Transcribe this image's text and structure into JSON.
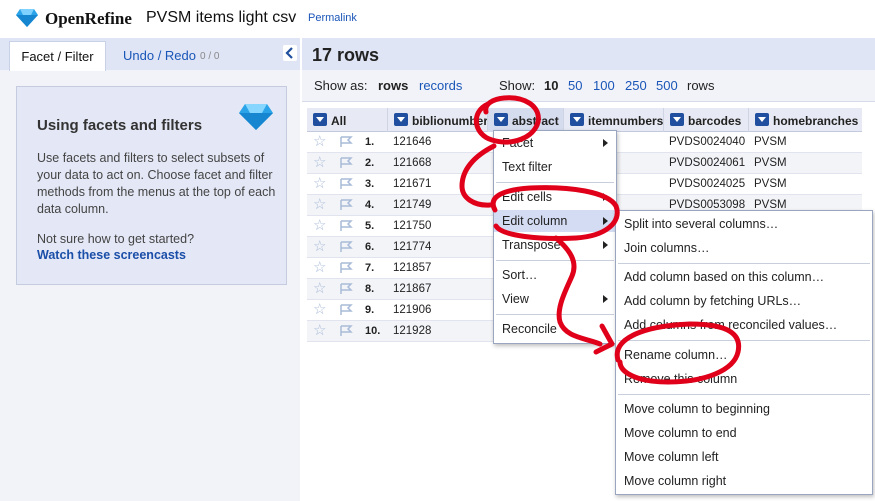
{
  "header": {
    "logo_text": "OpenRefine",
    "project_title": "PVSM items light csv",
    "permalink": "Permalink"
  },
  "left_panel": {
    "tab_facet": "Facet / Filter",
    "tab_undo": "Undo / Redo",
    "tab_undo_count": "0 / 0",
    "heading": "Using facets and filters",
    "description": "Use facets and filters to select subsets of your data to act on. Choose facet and filter methods from the menus at the top of each data column.",
    "help_question": "Not sure how to get started?",
    "help_link": "Watch these screencasts"
  },
  "main": {
    "row_count": "17 rows",
    "show_as_label": "Show as:",
    "mode_rows": "rows",
    "mode_records": "records",
    "show_label": "Show:",
    "page_sizes": [
      "10",
      "50",
      "100",
      "250",
      "500"
    ],
    "rows_suffix": "rows"
  },
  "table": {
    "columns": [
      "All",
      "biblionumber",
      "abstract",
      "itemnumbers",
      "barcodes",
      "homebranches"
    ],
    "rows": [
      {
        "n": "1.",
        "bib": "121646",
        "barcode": "PVDS0024040",
        "home": "PVSM"
      },
      {
        "n": "2.",
        "bib": "121668",
        "barcode": "PVDS0024061",
        "home": "PVSM"
      },
      {
        "n": "3.",
        "bib": "121671",
        "barcode": "PVDS0024025",
        "home": "PVSM"
      },
      {
        "n": "4.",
        "bib": "121749",
        "barcode": "PVDS0053098",
        "home": "PVSM"
      },
      {
        "n": "5.",
        "bib": "121750",
        "barcode": "",
        "home": ""
      },
      {
        "n": "6.",
        "bib": "121774",
        "barcode": "",
        "home": ""
      },
      {
        "n": "7.",
        "bib": "121857",
        "barcode": "",
        "home": ""
      },
      {
        "n": "8.",
        "bib": "121867",
        "barcode": "",
        "home": ""
      },
      {
        "n": "9.",
        "bib": "121906",
        "barcode": "",
        "home": ""
      },
      {
        "n": "10.",
        "bib": "121928",
        "barcode": "",
        "home": ""
      }
    ]
  },
  "column_menu": {
    "items": [
      "Facet",
      "Text filter",
      "Edit cells",
      "Edit column",
      "Transpose",
      "Sort…",
      "View",
      "Reconcile"
    ]
  },
  "edit_column_menu": {
    "items": [
      "Split into several columns…",
      "Join columns…",
      "Add column based on this column…",
      "Add column by fetching URLs…",
      "Add columns from reconciled values…",
      "Rename column…",
      "Remove this column",
      "Move column to beginning",
      "Move column to end",
      "Move column left",
      "Move column right"
    ]
  },
  "colors": {
    "accent": "#1a56b8",
    "annotation": "#e0001a",
    "header_bar": "#dfe5f5",
    "menu_highlight": "#d3dcf2"
  }
}
